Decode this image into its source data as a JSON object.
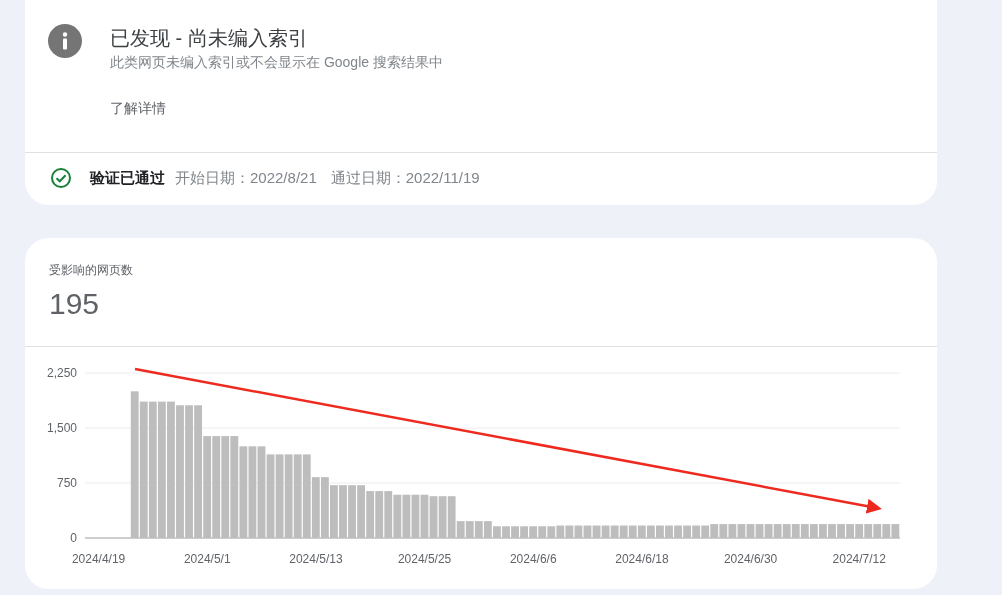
{
  "issue": {
    "title": "已发现 - 尚未编入索引",
    "description": "此类网页未编入索引或不会显示在 Google 搜索结果中",
    "link": "了解详情"
  },
  "validation": {
    "status": "验证已通过",
    "passed": true,
    "start": "开始日期：2022/8/21",
    "end": "通过日期：2022/11/19"
  },
  "affected": {
    "label": "受影响的网页数",
    "count": "195",
    "chart_data": {
      "type": "bar",
      "categories": [
        null,
        "2024/4/19",
        null,
        null,
        null,
        null,
        null,
        null,
        null,
        null,
        null,
        null,
        null,
        "2024/5/1",
        null,
        null,
        null,
        null,
        null,
        null,
        null,
        null,
        null,
        null,
        null,
        "2024/5/13",
        null,
        null,
        null,
        null,
        null,
        null,
        null,
        null,
        null,
        null,
        null,
        "2024/5/25",
        null,
        null,
        null,
        null,
        null,
        null,
        null,
        null,
        null,
        null,
        null,
        "2024/6/6",
        null,
        null,
        null,
        null,
        null,
        null,
        null,
        null,
        null,
        null,
        null,
        "2024/6/18",
        null,
        null,
        null,
        null,
        null,
        null,
        null,
        null,
        null,
        null,
        null,
        "2024/6/30",
        null,
        null,
        null,
        null,
        null,
        null,
        null,
        null,
        null,
        null,
        null,
        "2024/7/12",
        null,
        null,
        null,
        null
      ],
      "series": [
        {
          "color": "#bdbdbd",
          "values": [
            null,
            null,
            null,
            null,
            null,
            2000,
            1860,
            1860,
            1860,
            1860,
            1810,
            1810,
            1810,
            1390,
            1390,
            1390,
            1390,
            1250,
            1250,
            1250,
            1140,
            1140,
            1140,
            1140,
            1140,
            830,
            830,
            720,
            720,
            720,
            720,
            640,
            640,
            640,
            590,
            590,
            590,
            590,
            570,
            570,
            570,
            230,
            230,
            230,
            230,
            160,
            160,
            160,
            160,
            160,
            160,
            160,
            170,
            170,
            170,
            170,
            170,
            170,
            170,
            170,
            170,
            170,
            170,
            170,
            170,
            170,
            170,
            170,
            170,
            190,
            190,
            190,
            190,
            190,
            190,
            190,
            190,
            190,
            190,
            190,
            190,
            190,
            190,
            190,
            190,
            190,
            190,
            190,
            190,
            190
          ]
        }
      ],
      "ylim": [
        0,
        2250
      ],
      "yticks": [
        0,
        {
          "value": 750,
          "label": "750"
        },
        {
          "value": 1500,
          "label": "1,500"
        },
        {
          "value": 2250,
          "label": "2,250"
        }
      ]
    }
  }
}
